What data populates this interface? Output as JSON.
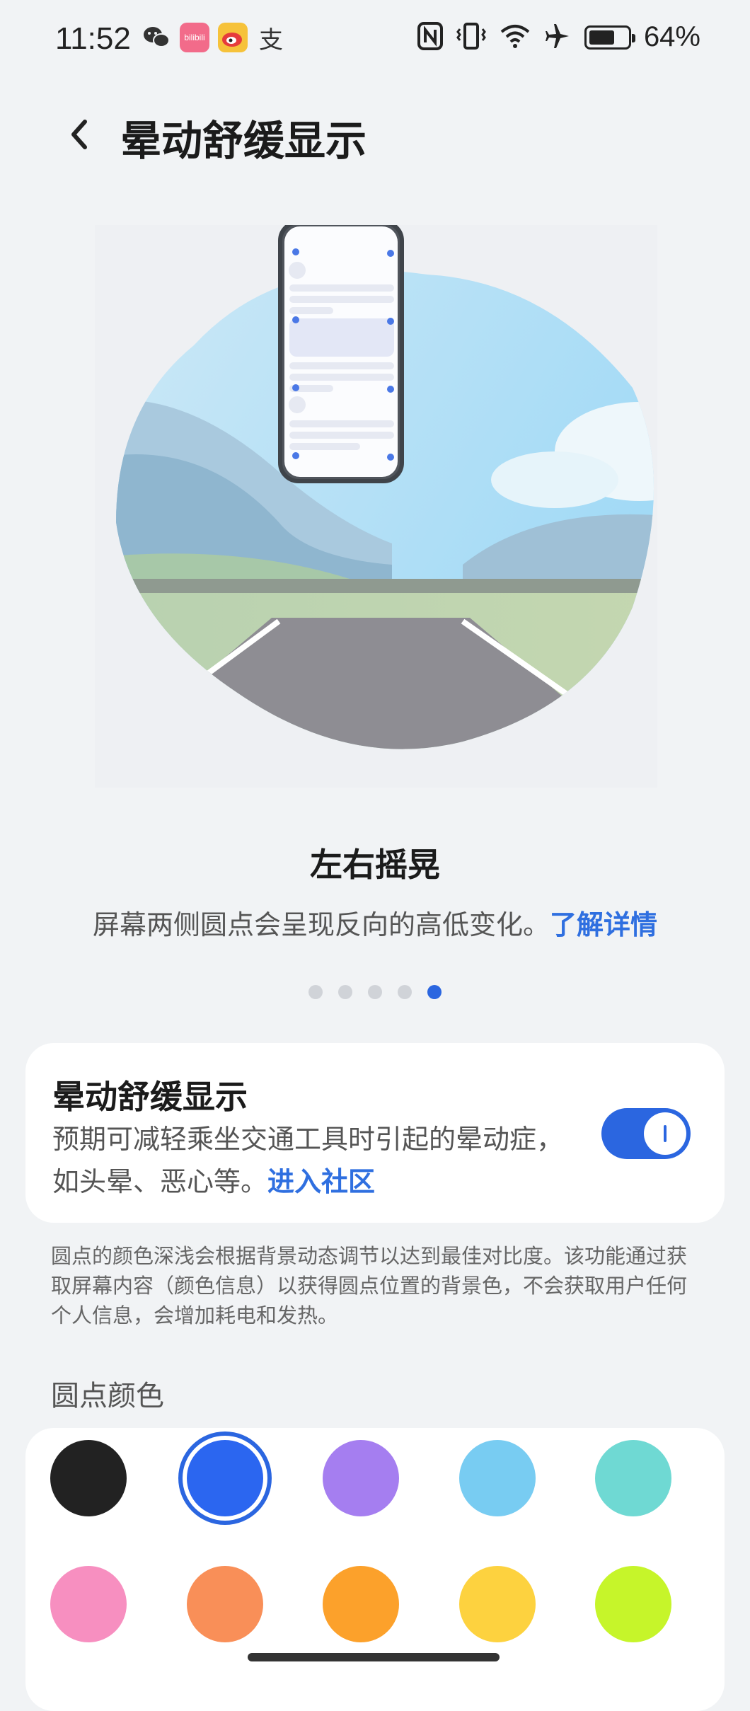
{
  "status_bar": {
    "time": "11:52",
    "battery_percent": "64%",
    "battery_level": 0.64,
    "left_icons": [
      "wechat-icon",
      "bilibili-icon",
      "weibo-icon",
      "alipay-icon"
    ],
    "right_icons": [
      "nfc-icon",
      "vibrate-icon",
      "wifi-icon",
      "airplane-icon",
      "battery-icon"
    ],
    "bilibili_text": "bilibili",
    "alipay_text": "支"
  },
  "header": {
    "title": "晕动舒缓显示"
  },
  "mode": {
    "title": "左右摇晃",
    "description": "屏幕两侧圆点会呈现反向的高低变化。",
    "learn_more": "了解详情"
  },
  "pager": {
    "count": 5,
    "active_index": 4
  },
  "feature": {
    "title": "晕动舒缓显示",
    "description": "预期可减轻乘坐交通工具时引起的晕动症，如头晕、恶心等。",
    "community_link": "进入社区",
    "enabled": true
  },
  "footnote": "圆点的颜色深浅会根据背景动态调节以达到最佳对比度。该功能通过获取屏幕内容（颜色信息）以获得圆点位置的背景色，不会获取用户任何个人信息，会增加耗电和发热。",
  "dot_color": {
    "label": "圆点颜色",
    "selected_index": 1,
    "colors": [
      "#222222",
      "#2b66f0",
      "#a57ef0",
      "#78ccf2",
      "#6fd9d3",
      "#f78fc0",
      "#f98f58",
      "#fca12b",
      "#fdd23f",
      "#c6f52a"
    ]
  },
  "colors": {
    "accent": "#2b66e0",
    "link": "#2f6fe0"
  }
}
